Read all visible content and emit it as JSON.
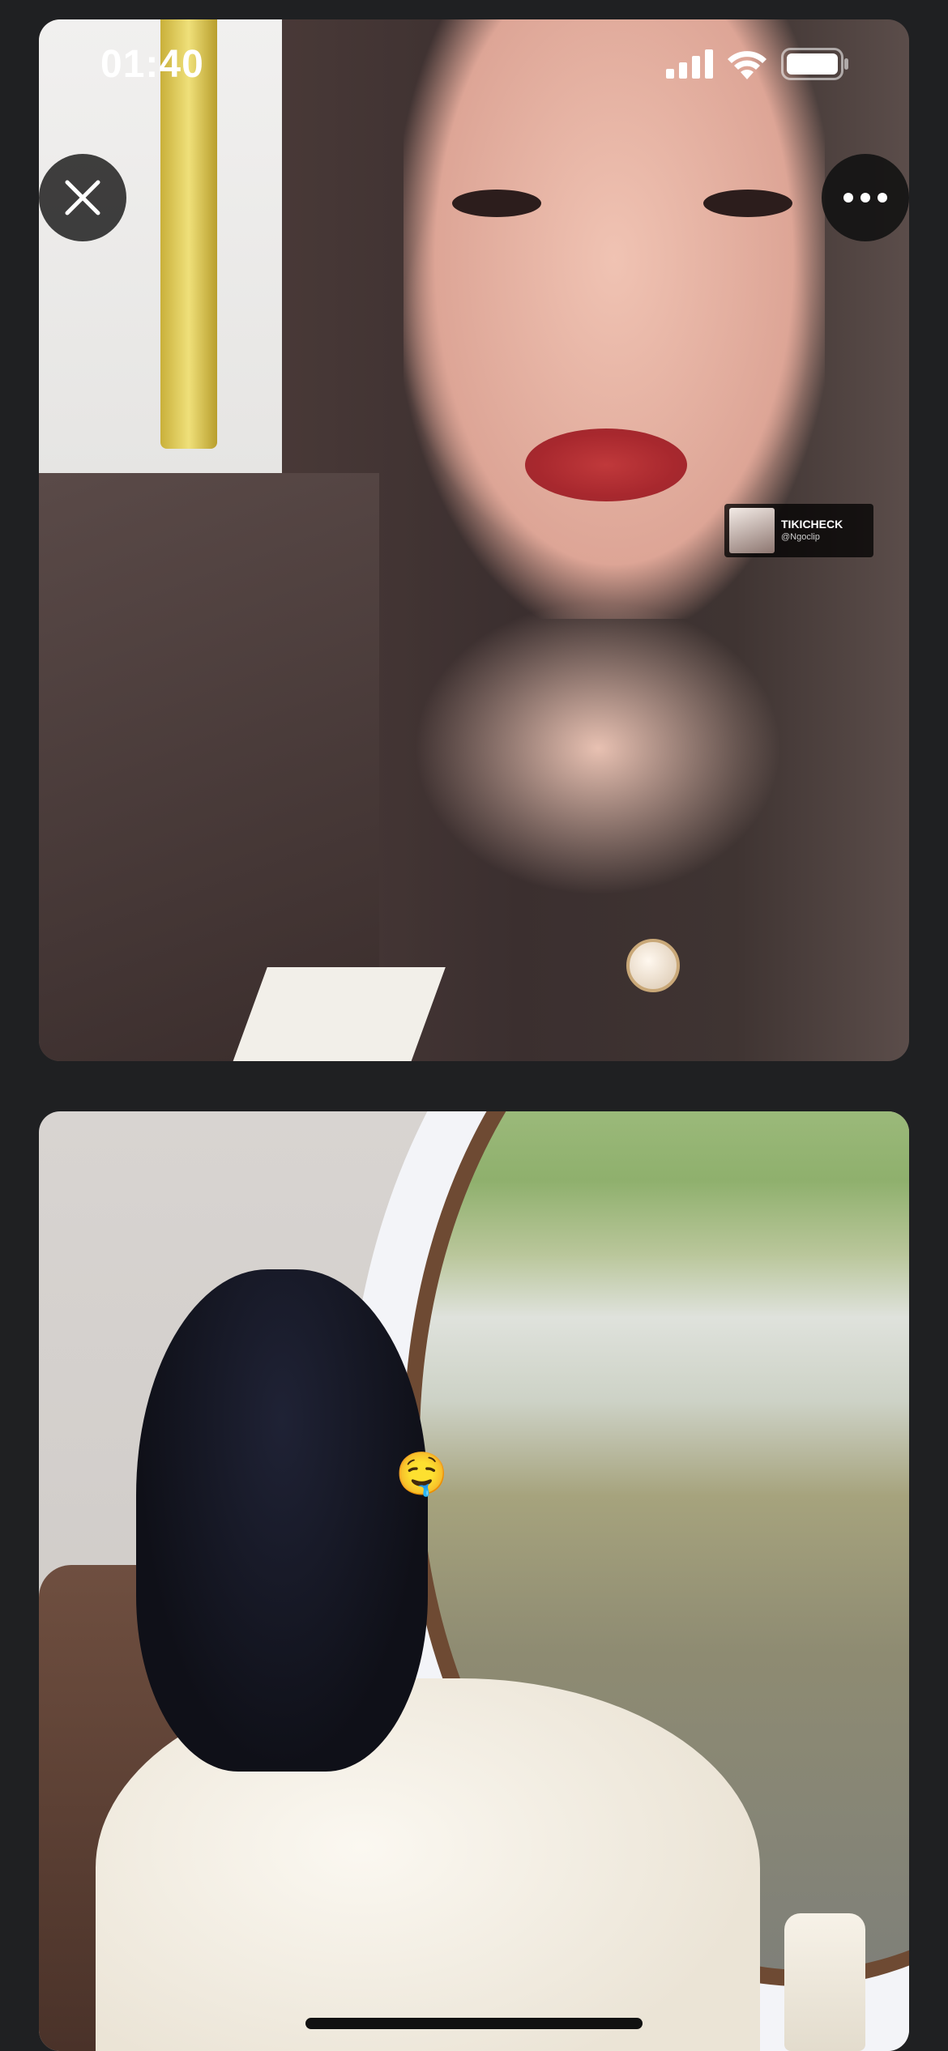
{
  "status_bar": {
    "time": "01:40",
    "icons": [
      "cellular-signal-icon",
      "wifi-icon",
      "battery-icon"
    ]
  },
  "top_bar": {
    "close_icon": "close-icon",
    "more_icon": "more-horizontal-icon"
  },
  "photos": [
    {
      "description_visible": false,
      "watermark": {
        "title": "TIKICHECK",
        "subtitle": "@Ngoclip"
      }
    },
    {
      "sticker_emoji": "🤤"
    }
  ],
  "colors": {
    "background": "#1f2022",
    "button_bg": "#1e1e1e",
    "icon": "#ffffff"
  }
}
